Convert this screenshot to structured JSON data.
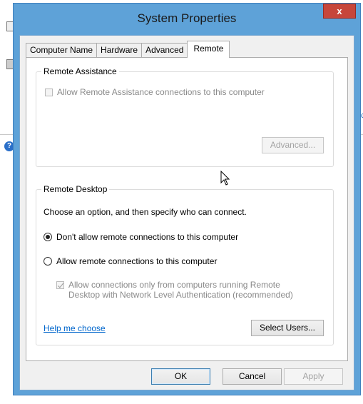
{
  "background": {
    "fragment_text": "ec"
  },
  "window": {
    "title": "System Properties",
    "close_label": "x"
  },
  "tabs": [
    {
      "label": "Computer Name"
    },
    {
      "label": "Hardware"
    },
    {
      "label": "Advanced"
    },
    {
      "label": "Remote"
    }
  ],
  "remote_assistance": {
    "group_title": "Remote Assistance",
    "allow_checkbox_label": "Allow Remote Assistance connections to this computer",
    "allow_checked": false,
    "advanced_button": "Advanced..."
  },
  "remote_desktop": {
    "group_title": "Remote Desktop",
    "instruction": "Choose an option, and then specify who can connect.",
    "option_dont_allow": "Don't allow remote connections to this computer",
    "option_allow": "Allow remote connections to this computer",
    "selected_option": "dont_allow",
    "nla_line1": "Allow connections only from computers running Remote",
    "nla_line2": "Desktop with Network Level Authentication (recommended)",
    "nla_checked": true,
    "help_link": "Help me choose",
    "select_users_button": "Select Users..."
  },
  "footer": {
    "ok": "OK",
    "cancel": "Cancel",
    "apply": "Apply"
  },
  "colors": {
    "titlebar": "#5ea2d8",
    "close": "#c7463b",
    "link": "#0066cc"
  }
}
